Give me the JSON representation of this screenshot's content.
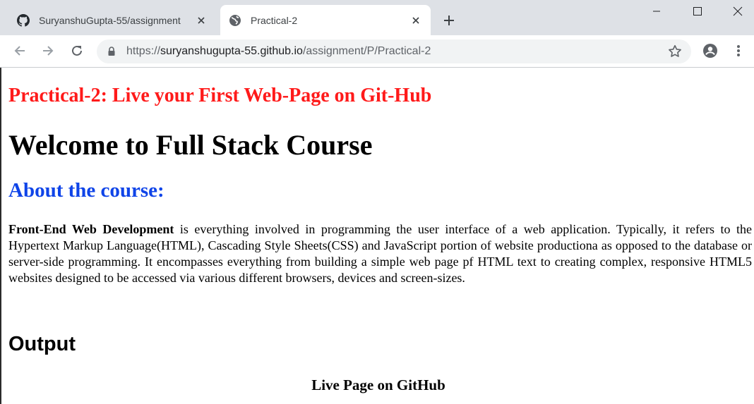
{
  "browser": {
    "tabs": [
      {
        "title": "SuryanshuGupta-55/assignment",
        "icon": "github-icon",
        "active": false
      },
      {
        "title": "Practical-2",
        "icon": "globe-icon",
        "active": true
      }
    ],
    "url": {
      "scheme": "https://",
      "host": "suryanshugupta-55.github.io",
      "path": "/assignment/P/Practical-2"
    }
  },
  "page": {
    "practical_title": "Practical-2: Live your First Web-Page on Git-Hub",
    "welcome_heading": "Welcome to Full Stack Course",
    "about_heading": "About the course:",
    "paragraph_bold": "Front-End Web Development",
    "paragraph_text": " is everything involved in programming the user interface of a web application. Typically, it refers to the Hypertext Markup Language(HTML), Cascading Style Sheets(CSS) and JavaScript portion of website productiona as opposed to the database or server-side programming. It encompasses everything from building a simple web page pf HTML text to creating complex, responsive HTML5 websites designed to be accessed via various different browsers, devices and screen-sizes.",
    "output_heading": "Output",
    "live_page_caption": "Live Page on GitHub"
  },
  "colors": {
    "title_red": "#ff1a1a",
    "about_blue": "#0f44e8",
    "tabstrip_bg": "#dee1e6",
    "omnibox_bg": "#f1f3f4"
  }
}
